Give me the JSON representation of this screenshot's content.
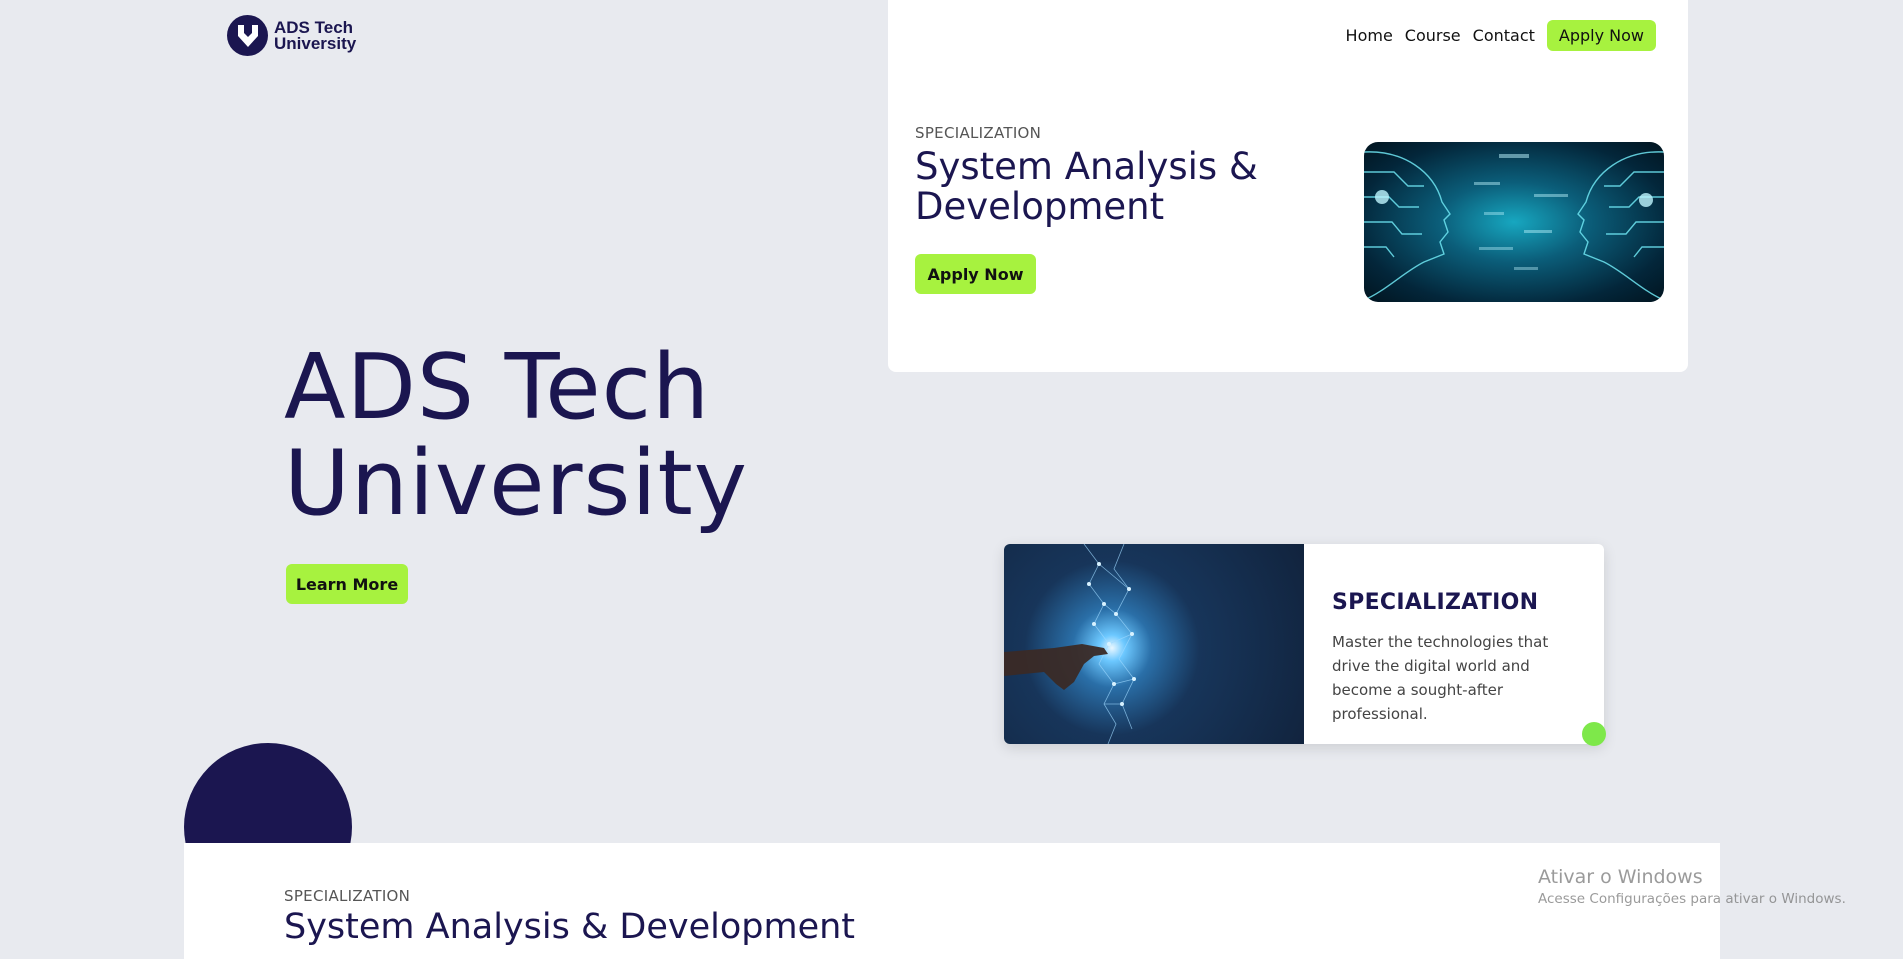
{
  "brand": {
    "line1": "ADS Tech",
    "line2": "University",
    "colors": {
      "navy": "#1b1650",
      "lime": "#a7f23f",
      "background": "#e8eaef"
    }
  },
  "nav": {
    "items": [
      "Home",
      "Course",
      "Contact"
    ],
    "apply_label": "Apply Now"
  },
  "top_card": {
    "eyebrow": "SPECIALIZATION",
    "title_line1": "System Analysis &",
    "title_line2": "Development",
    "apply_label": "Apply Now",
    "image_icon": "ai-faces-circuit-image"
  },
  "hero": {
    "title_line1": "ADS Tech",
    "title_line2": "University",
    "cta_label": "Learn More"
  },
  "feature_card": {
    "image_icon": "hand-network-image",
    "heading": "SPECIALIZATION",
    "text": "Master the technologies that drive the digital world and become a sought-after professional."
  },
  "bottom_section": {
    "eyebrow": "SPECIALIZATION",
    "title": "System Analysis & Development"
  },
  "watermark": {
    "title": "Ativar o Windows",
    "subtitle": "Acesse Configurações para ativar o Windows."
  }
}
